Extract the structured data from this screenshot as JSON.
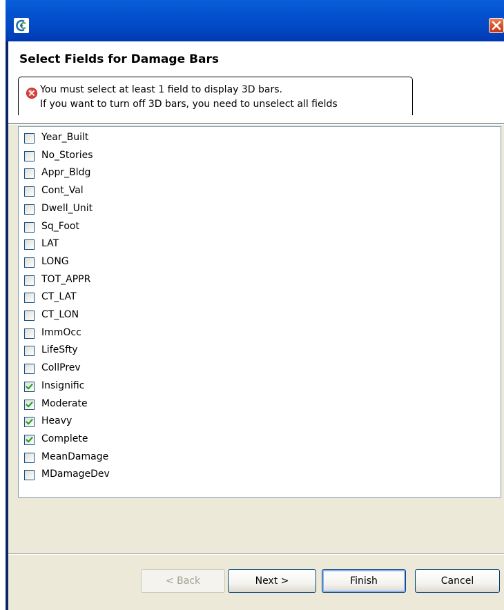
{
  "window": {
    "title": "",
    "app_icon": "app-logo-icon",
    "close_icon": "close-icon"
  },
  "page": {
    "title": "Select Fields for Damage Bars",
    "error_icon": "error-icon",
    "message_line1": "You must select at least 1 field to display 3D bars.",
    "message_line2": "If you want to turn off 3D bars, you need to unselect all fields"
  },
  "fields": [
    {
      "label": "Year_Built",
      "checked": false
    },
    {
      "label": "No_Stories",
      "checked": false
    },
    {
      "label": "Appr_Bldg",
      "checked": false
    },
    {
      "label": "Cont_Val",
      "checked": false
    },
    {
      "label": "Dwell_Unit",
      "checked": false
    },
    {
      "label": "Sq_Foot",
      "checked": false
    },
    {
      "label": "LAT",
      "checked": false
    },
    {
      "label": "LONG",
      "checked": false
    },
    {
      "label": "TOT_APPR",
      "checked": false
    },
    {
      "label": "CT_LAT",
      "checked": false
    },
    {
      "label": "CT_LON",
      "checked": false
    },
    {
      "label": "ImmOcc",
      "checked": false
    },
    {
      "label": "LifeSfty",
      "checked": false
    },
    {
      "label": "CollPrev",
      "checked": false
    },
    {
      "label": "Insignific",
      "checked": true
    },
    {
      "label": "Moderate",
      "checked": true
    },
    {
      "label": "Heavy",
      "checked": true
    },
    {
      "label": "Complete",
      "checked": true
    },
    {
      "label": "MeanDamage",
      "checked": false
    },
    {
      "label": "MDamageDev",
      "checked": false
    }
  ],
  "buttons": {
    "back": "< Back",
    "next": "Next >",
    "finish": "Finish",
    "cancel": "Cancel"
  },
  "colors": {
    "titlebar": "#0553d1",
    "close_button": "#d8532c",
    "check_mark": "#21a121",
    "dialog_bg": "#ece9d8"
  }
}
